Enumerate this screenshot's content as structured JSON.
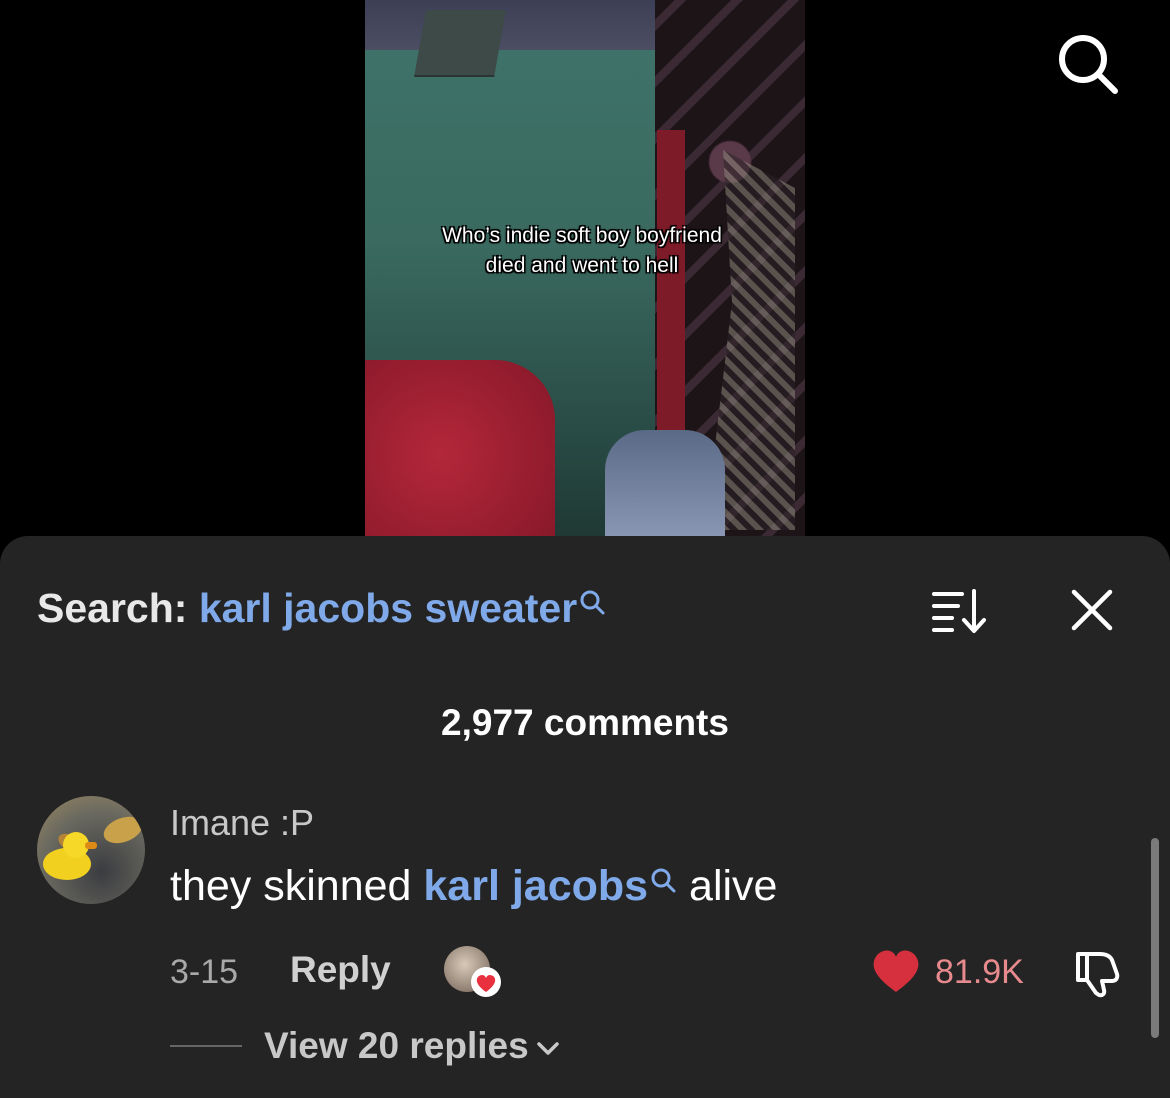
{
  "video": {
    "caption": "Who’s indie soft boy boyfriend died and went to hell"
  },
  "search_bar": {
    "label": "Search:",
    "term": "karl jacobs sweater"
  },
  "comments": {
    "count_label": "2,977 comments",
    "items": [
      {
        "username": "Imane :P",
        "text_before": "they skinned",
        "link_text": "karl jacobs",
        "text_after": "alive",
        "date": "3-15",
        "reply_label": "Reply",
        "like_count": "81.9K",
        "view_replies_label": "View 20 replies"
      }
    ]
  },
  "colors": {
    "sheet_bg": "#242424",
    "link": "#7fa9e8",
    "like": "#d6303f"
  },
  "icons": [
    "search-icon",
    "sort-icon",
    "close-icon",
    "heart-icon",
    "dislike-icon",
    "chevron-down-icon"
  ]
}
